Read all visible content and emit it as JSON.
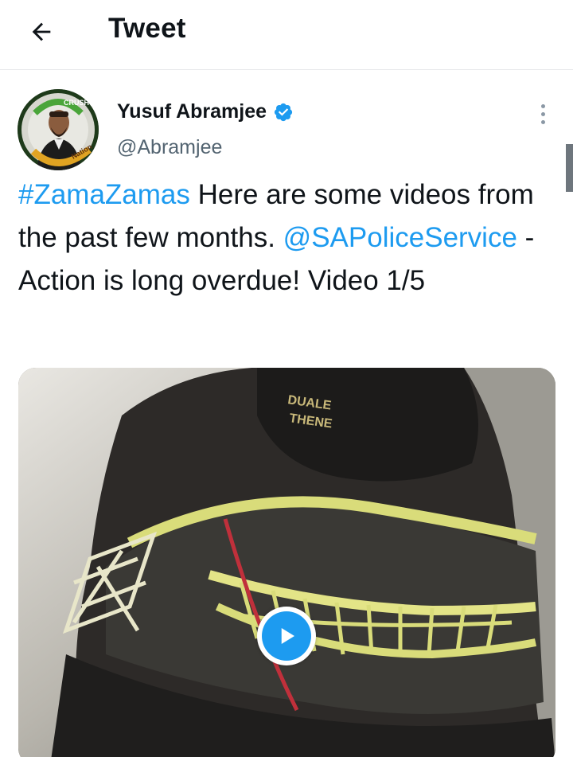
{
  "header": {
    "back_icon": "arrow-left-icon",
    "title": "Tweet"
  },
  "tweet": {
    "author": {
      "display_name": "Yusuf Abramjee",
      "handle": "@Abramjee",
      "verified": true,
      "verified_icon": "verified-badge-icon",
      "avatar_icon": "avatar-photo",
      "avatar_ring_text": "#CrushNation"
    },
    "more_icon": "more-vertical-icon",
    "text": {
      "hashtag": "#ZamaZamas",
      "part1": " Here are some videos from the past few months. ",
      "mention": "@SAPoliceService",
      "part2": " - Action is long overdue! Video 1/5"
    },
    "media": {
      "type": "video",
      "play_icon": "play-icon",
      "balaclava_text": "DUALE\nTHENE"
    }
  },
  "colors": {
    "accent": "#1d9bf0",
    "text_primary": "#0f1419",
    "text_secondary": "#536471",
    "divider": "#e6e8ea"
  }
}
